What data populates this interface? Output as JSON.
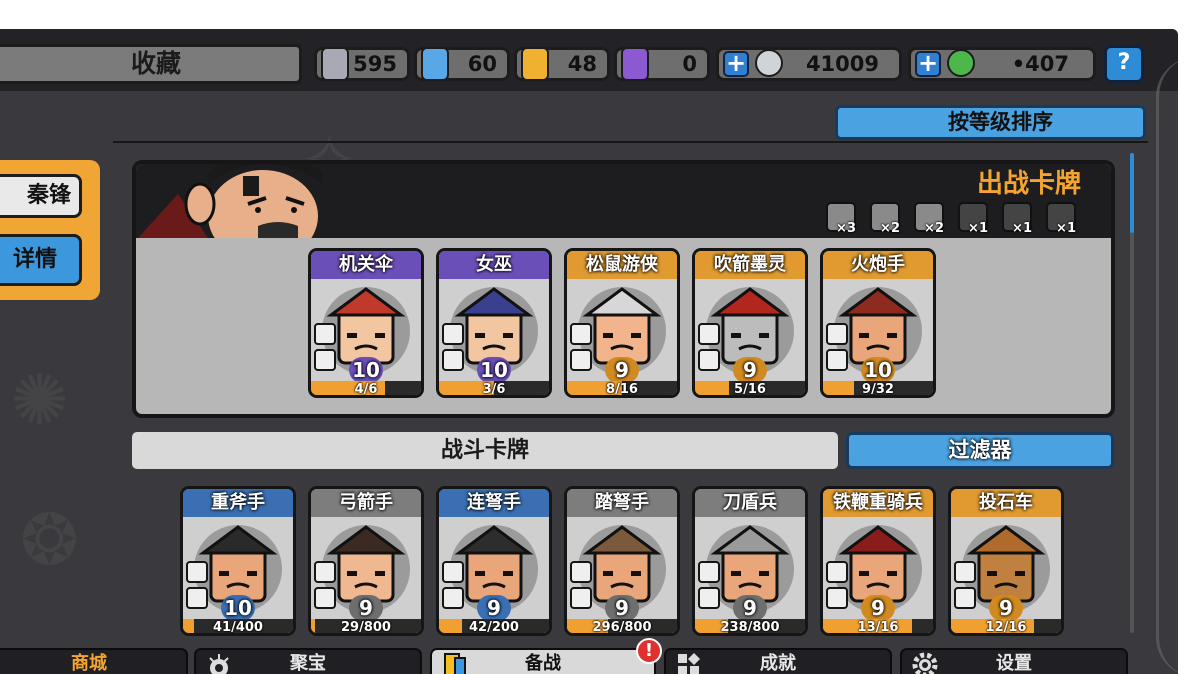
{
  "header": {
    "title": "收藏",
    "resources": [
      {
        "name": "silver-shard",
        "value": "595",
        "color": "#a9a9b5"
      },
      {
        "name": "blue-crystal",
        "value": "60",
        "color": "#58a8e8"
      },
      {
        "name": "gold-crest",
        "value": "48",
        "color": "#f0b030"
      },
      {
        "name": "purple-crest",
        "value": "0",
        "color": "#8c5ad0"
      }
    ],
    "coins": {
      "value": "41009",
      "plus": "+"
    },
    "gems": {
      "value": "•407",
      "plus": "+"
    },
    "help": "?"
  },
  "hero": {
    "name": "秦锋",
    "detail_button": "详情"
  },
  "sort_button": "按等级排序",
  "deck": {
    "title": "出战卡牌",
    "slots": [
      {
        "icon": "crossbow-icon",
        "mult": "×3",
        "active": true
      },
      {
        "icon": "skull-icon",
        "mult": "×2",
        "active": true
      },
      {
        "icon": "helmet-icon",
        "mult": "×2",
        "active": true
      },
      {
        "icon": "knight-helm-icon",
        "mult": "×1",
        "active": false
      },
      {
        "icon": "wing-icon",
        "mult": "×1",
        "active": false
      },
      {
        "icon": "armor-icon",
        "mult": "×1",
        "active": false
      }
    ],
    "cards": [
      {
        "name": "机关伞",
        "level": "10",
        "progress": "4/6",
        "rarity": "purple",
        "fill": 0.67,
        "hat": "#c0392b",
        "face": "#f2c6a0"
      },
      {
        "name": "女巫",
        "level": "10",
        "progress": "3/6",
        "rarity": "purple",
        "fill": 0.5,
        "hat": "#3b3f8f",
        "face": "#f2c6a0"
      },
      {
        "name": "松鼠游侠",
        "level": "9",
        "progress": "8/16",
        "rarity": "gold",
        "fill": 0.5,
        "hat": "#d7d7d7",
        "face": "#f2b48c"
      },
      {
        "name": "吹箭墨灵",
        "level": "9",
        "progress": "5/16",
        "rarity": "gold",
        "fill": 0.31,
        "hat": "#b3261e",
        "face": "#bcbcbc"
      },
      {
        "name": "火炮手",
        "level": "10",
        "progress": "9/32",
        "rarity": "gold",
        "fill": 0.28,
        "hat": "#8e2b1e",
        "face": "#e8a67a"
      }
    ]
  },
  "battle": {
    "title": "战斗卡牌",
    "filter_button": "过滤器",
    "cards": [
      {
        "name": "重斧手",
        "level": "10",
        "progress": "41/400",
        "rarity": "blue",
        "fill": 0.1,
        "hat": "#2a2a2a",
        "face": "#e8a67a"
      },
      {
        "name": "弓箭手",
        "level": "9",
        "progress": "29/800",
        "rarity": "gray",
        "fill": 0.04,
        "hat": "#3a2a22",
        "face": "#f0b890"
      },
      {
        "name": "连弩手",
        "level": "9",
        "progress": "42/200",
        "rarity": "blue",
        "fill": 0.21,
        "hat": "#2d2d2d",
        "face": "#e8a67a"
      },
      {
        "name": "踏弩手",
        "level": "9",
        "progress": "296/800",
        "rarity": "gray",
        "fill": 0.37,
        "hat": "#7a5a3a",
        "face": "#e8a67a"
      },
      {
        "name": "刀盾兵",
        "level": "9",
        "progress": "238/800",
        "rarity": "gray",
        "fill": 0.3,
        "hat": "#9a9a9a",
        "face": "#e8a67a"
      },
      {
        "name": "铁鞭重骑兵",
        "level": "9",
        "progress": "13/16",
        "rarity": "gold",
        "fill": 0.81,
        "hat": "#8a1c1c",
        "face": "#e8a67a"
      },
      {
        "name": "投石车",
        "level": "9",
        "progress": "12/16",
        "rarity": "gold",
        "fill": 0.75,
        "hat": "#b06a2c",
        "face": "#c08040"
      }
    ]
  },
  "nav": [
    {
      "label": "商城",
      "icon": "shop-icon"
    },
    {
      "label": "聚宝",
      "icon": "treasure-icon"
    },
    {
      "label": "备战",
      "icon": "cards-icon",
      "alert": "!"
    },
    {
      "label": "成就",
      "icon": "achievement-icon"
    },
    {
      "label": "设置",
      "icon": "gear-icon"
    }
  ]
}
